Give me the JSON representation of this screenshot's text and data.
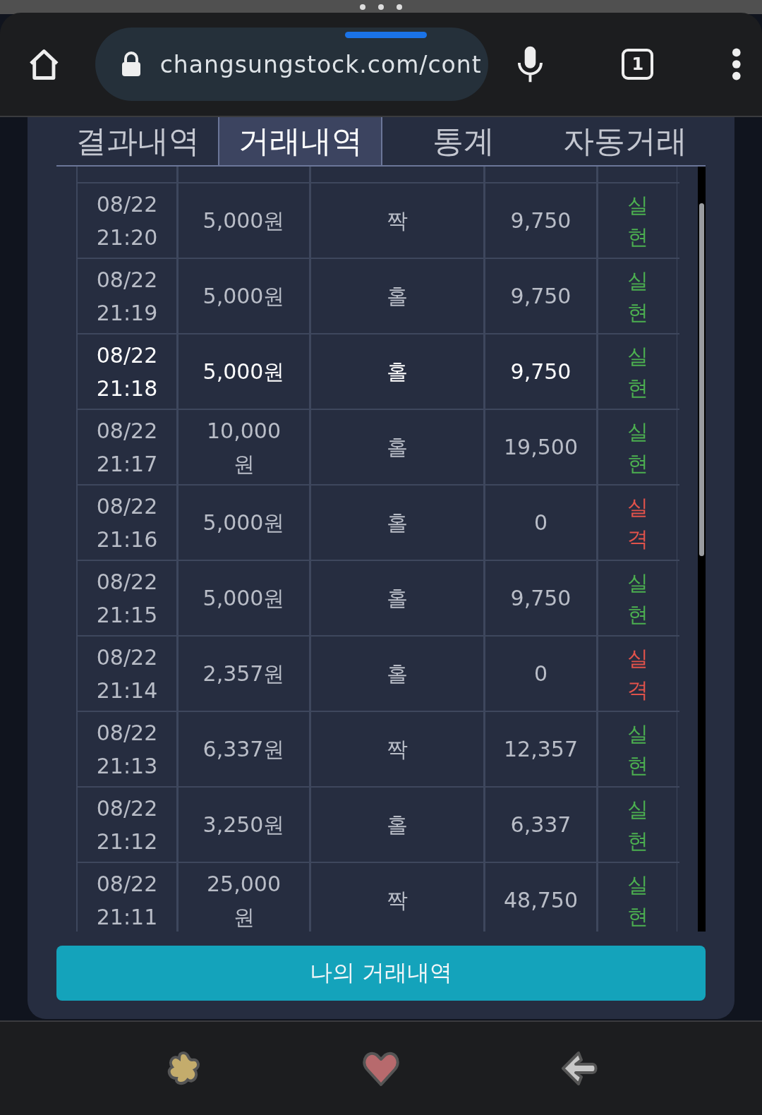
{
  "browser": {
    "url": "changsungstock.com/cont",
    "tab_count": "1"
  },
  "tabs": [
    {
      "label": "결과내역",
      "selected": false
    },
    {
      "label": "거래내역",
      "selected": true
    },
    {
      "label": "통계",
      "selected": false
    },
    {
      "label": "자동거래",
      "selected": false
    }
  ],
  "table": {
    "rows": [
      {
        "date": "08/22",
        "time": "21:20",
        "amount": "5,000원",
        "pick": "짝",
        "payout": "9,750",
        "result": "실현",
        "color": "#4caf50",
        "selected": false
      },
      {
        "date": "08/22",
        "time": "21:19",
        "amount": "5,000원",
        "pick": "홀",
        "payout": "9,750",
        "result": "실현",
        "color": "#4caf50",
        "selected": false
      },
      {
        "date": "08/22",
        "time": "21:18",
        "amount": "5,000원",
        "pick": "홀",
        "payout": "9,750",
        "result": "실현",
        "color": "#4caf50",
        "selected": true
      },
      {
        "date": "08/22",
        "time": "21:17",
        "amount": "10,000원",
        "pick": "홀",
        "payout": "19,500",
        "result": "실현",
        "color": "#4caf50",
        "selected": false
      },
      {
        "date": "08/22",
        "time": "21:16",
        "amount": "5,000원",
        "pick": "홀",
        "payout": "0",
        "result": "실격",
        "color": "#e0524b",
        "selected": false
      },
      {
        "date": "08/22",
        "time": "21:15",
        "amount": "5,000원",
        "pick": "홀",
        "payout": "9,750",
        "result": "실현",
        "color": "#4caf50",
        "selected": false
      },
      {
        "date": "08/22",
        "time": "21:14",
        "amount": "2,357원",
        "pick": "홀",
        "payout": "0",
        "result": "실격",
        "color": "#e0524b",
        "selected": false
      },
      {
        "date": "08/22",
        "time": "21:13",
        "amount": "6,337원",
        "pick": "짝",
        "payout": "12,357",
        "result": "실현",
        "color": "#4caf50",
        "selected": false
      },
      {
        "date": "08/22",
        "time": "21:12",
        "amount": "3,250원",
        "pick": "홀",
        "payout": "6,337",
        "result": "실현",
        "color": "#4caf50",
        "selected": false
      },
      {
        "date": "08/22",
        "time": "21:11",
        "amount": "25,000원",
        "pick": "짝",
        "payout": "48,750",
        "result": "실현",
        "color": "#4caf50",
        "selected": false
      }
    ]
  },
  "button": {
    "label": "나의 거래내역"
  }
}
